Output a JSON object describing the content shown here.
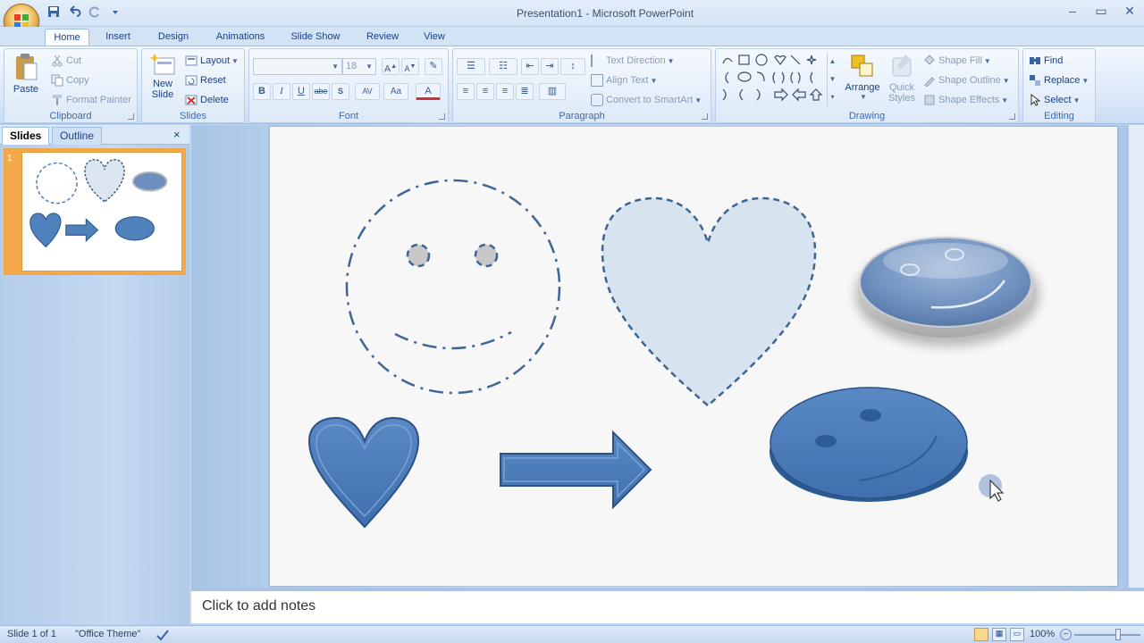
{
  "window": {
    "title": "Presentation1 - Microsoft PowerPoint"
  },
  "tabs": [
    "Home",
    "Insert",
    "Design",
    "Animations",
    "Slide Show",
    "Review",
    "View"
  ],
  "ribbon": {
    "clipboard": {
      "label": "Clipboard",
      "paste": "Paste",
      "cut": "Cut",
      "copy": "Copy",
      "format_painter": "Format Painter"
    },
    "slides": {
      "label": "Slides",
      "new_slide_line1": "New",
      "new_slide_line2": "Slide",
      "layout": "Layout",
      "reset": "Reset",
      "delete": "Delete"
    },
    "font": {
      "label": "Font",
      "font_size": "18",
      "bold": "B",
      "italic": "I",
      "underline": "U",
      "strike": "abe",
      "spacing": "AV",
      "case": "Aa",
      "color": "A"
    },
    "paragraph": {
      "label": "Paragraph",
      "text_direction": "Text Direction",
      "align_text": "Align Text",
      "convert_smartart": "Convert to SmartArt"
    },
    "drawing": {
      "label": "Drawing",
      "arrange": "Arrange",
      "quick_styles_line1": "Quick",
      "quick_styles_line2": "Styles",
      "shape_fill": "Shape Fill",
      "shape_outline": "Shape Outline",
      "shape_effects": "Shape Effects"
    },
    "editing": {
      "label": "Editing",
      "find": "Find",
      "replace": "Replace",
      "select": "Select"
    }
  },
  "pane": {
    "tabs": [
      "Slides",
      "Outline"
    ],
    "slide_number": "1",
    "close": "×"
  },
  "notes": {
    "placeholder": "Click to add notes"
  },
  "status": {
    "slide": "Slide 1 of 1",
    "theme": "\"Office Theme\"",
    "zoom": "100%"
  },
  "icons": [
    "office-button-icon",
    "save-icon",
    "undo-icon",
    "redo-icon",
    "paste-icon",
    "cut-icon",
    "copy-icon",
    "format-painter-icon",
    "new-slide-icon",
    "find-icon",
    "replace-icon",
    "select-icon"
  ],
  "colors": {
    "accent": "#4f81bd",
    "ribbon": "#dbe8f7",
    "selection": "#f6a94a"
  }
}
